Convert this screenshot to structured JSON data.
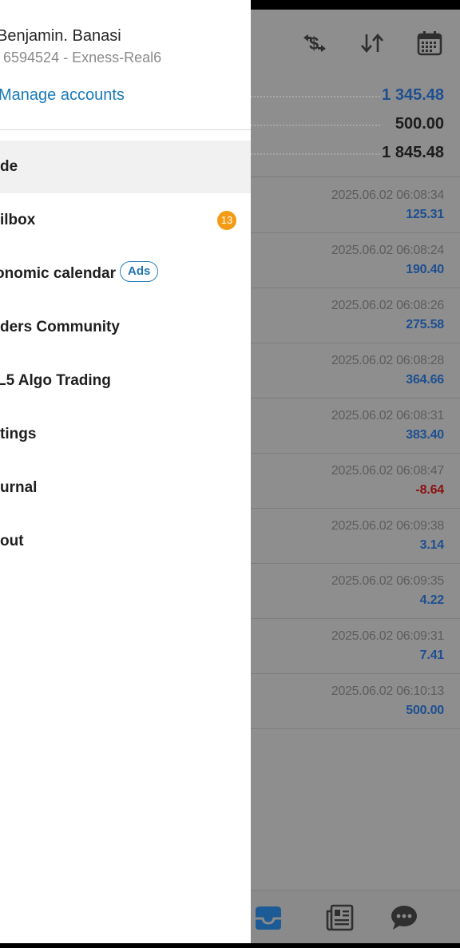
{
  "drawer": {
    "account": {
      "name": "Benjamin. Banasi",
      "id_line": "6594524 - Exness-Real6",
      "manage_accounts": "Manage accounts"
    },
    "menu": [
      {
        "label": "de",
        "active": true
      },
      {
        "label": "ilbox",
        "badge": "13"
      },
      {
        "label": "onomic calendar",
        "chip": "Ads"
      },
      {
        "label": "ders Community"
      },
      {
        "label": "L5 Algo Trading"
      },
      {
        "label": "tings"
      },
      {
        "label": "urnal"
      },
      {
        "label": "out"
      }
    ]
  },
  "history": {
    "toolbar_icons": [
      "currency-exchange-icon",
      "sort-icon",
      "calendar-icon"
    ],
    "summary": {
      "profit": "1 345.48",
      "deposit": "500.00",
      "balance": "1 845.48"
    },
    "deals": [
      {
        "time": "2025.06.02 06:08:34",
        "profit": "125.31",
        "negative": false
      },
      {
        "time": "2025.06.02 06:08:24",
        "profit": "190.40",
        "negative": false
      },
      {
        "time": "2025.06.02 06:08:26",
        "profit": "275.58",
        "negative": false
      },
      {
        "time": "2025.06.02 06:08:28",
        "profit": "364.66",
        "negative": false
      },
      {
        "time": "2025.06.02 06:08:31",
        "profit": "383.40",
        "negative": false
      },
      {
        "time": "2025.06.02 06:08:47",
        "profit": "-8.64",
        "negative": true
      },
      {
        "time": "2025.06.02 06:09:38",
        "profit": "3.14",
        "negative": false
      },
      {
        "time": "2025.06.02 06:09:35",
        "profit": "4.22",
        "negative": false
      },
      {
        "time": "2025.06.02 06:09:31",
        "profit": "7.41",
        "negative": false
      },
      {
        "time": "2025.06.02 06:10:13",
        "profit": "500.00",
        "negative": false
      }
    ],
    "bottom_nav": [
      "inbox-tray-icon",
      "news-icon",
      "chat-icon"
    ]
  },
  "colors": {
    "accent": "#1a7ab8",
    "badge": "#f39b14",
    "profit_positive": "#1d4f91",
    "profit_negative": "#8c1010",
    "overlay": "#8e8e8e"
  }
}
